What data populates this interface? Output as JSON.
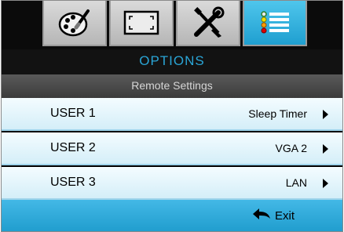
{
  "tabs": [
    {
      "icon": "palette-icon",
      "active": false
    },
    {
      "icon": "screen-resize-icon",
      "active": false
    },
    {
      "icon": "tools-icon",
      "active": false
    },
    {
      "icon": "options-list-icon",
      "active": true
    }
  ],
  "header": {
    "title": "OPTIONS",
    "subtitle": "Remote Settings"
  },
  "rows": [
    {
      "label": "USER 1",
      "value": "Sleep Timer"
    },
    {
      "label": "USER 2",
      "value": "VGA 2"
    },
    {
      "label": "USER 3",
      "value": "LAN"
    }
  ],
  "footer": {
    "exit_label": "Exit",
    "exit_icon": "back-arrow-icon"
  },
  "colors": {
    "accent": "#2aa5d6",
    "active_tab": "#35b3e3",
    "row_bg": "#e6f6fc",
    "footer_bg": "#2ea9d9"
  }
}
